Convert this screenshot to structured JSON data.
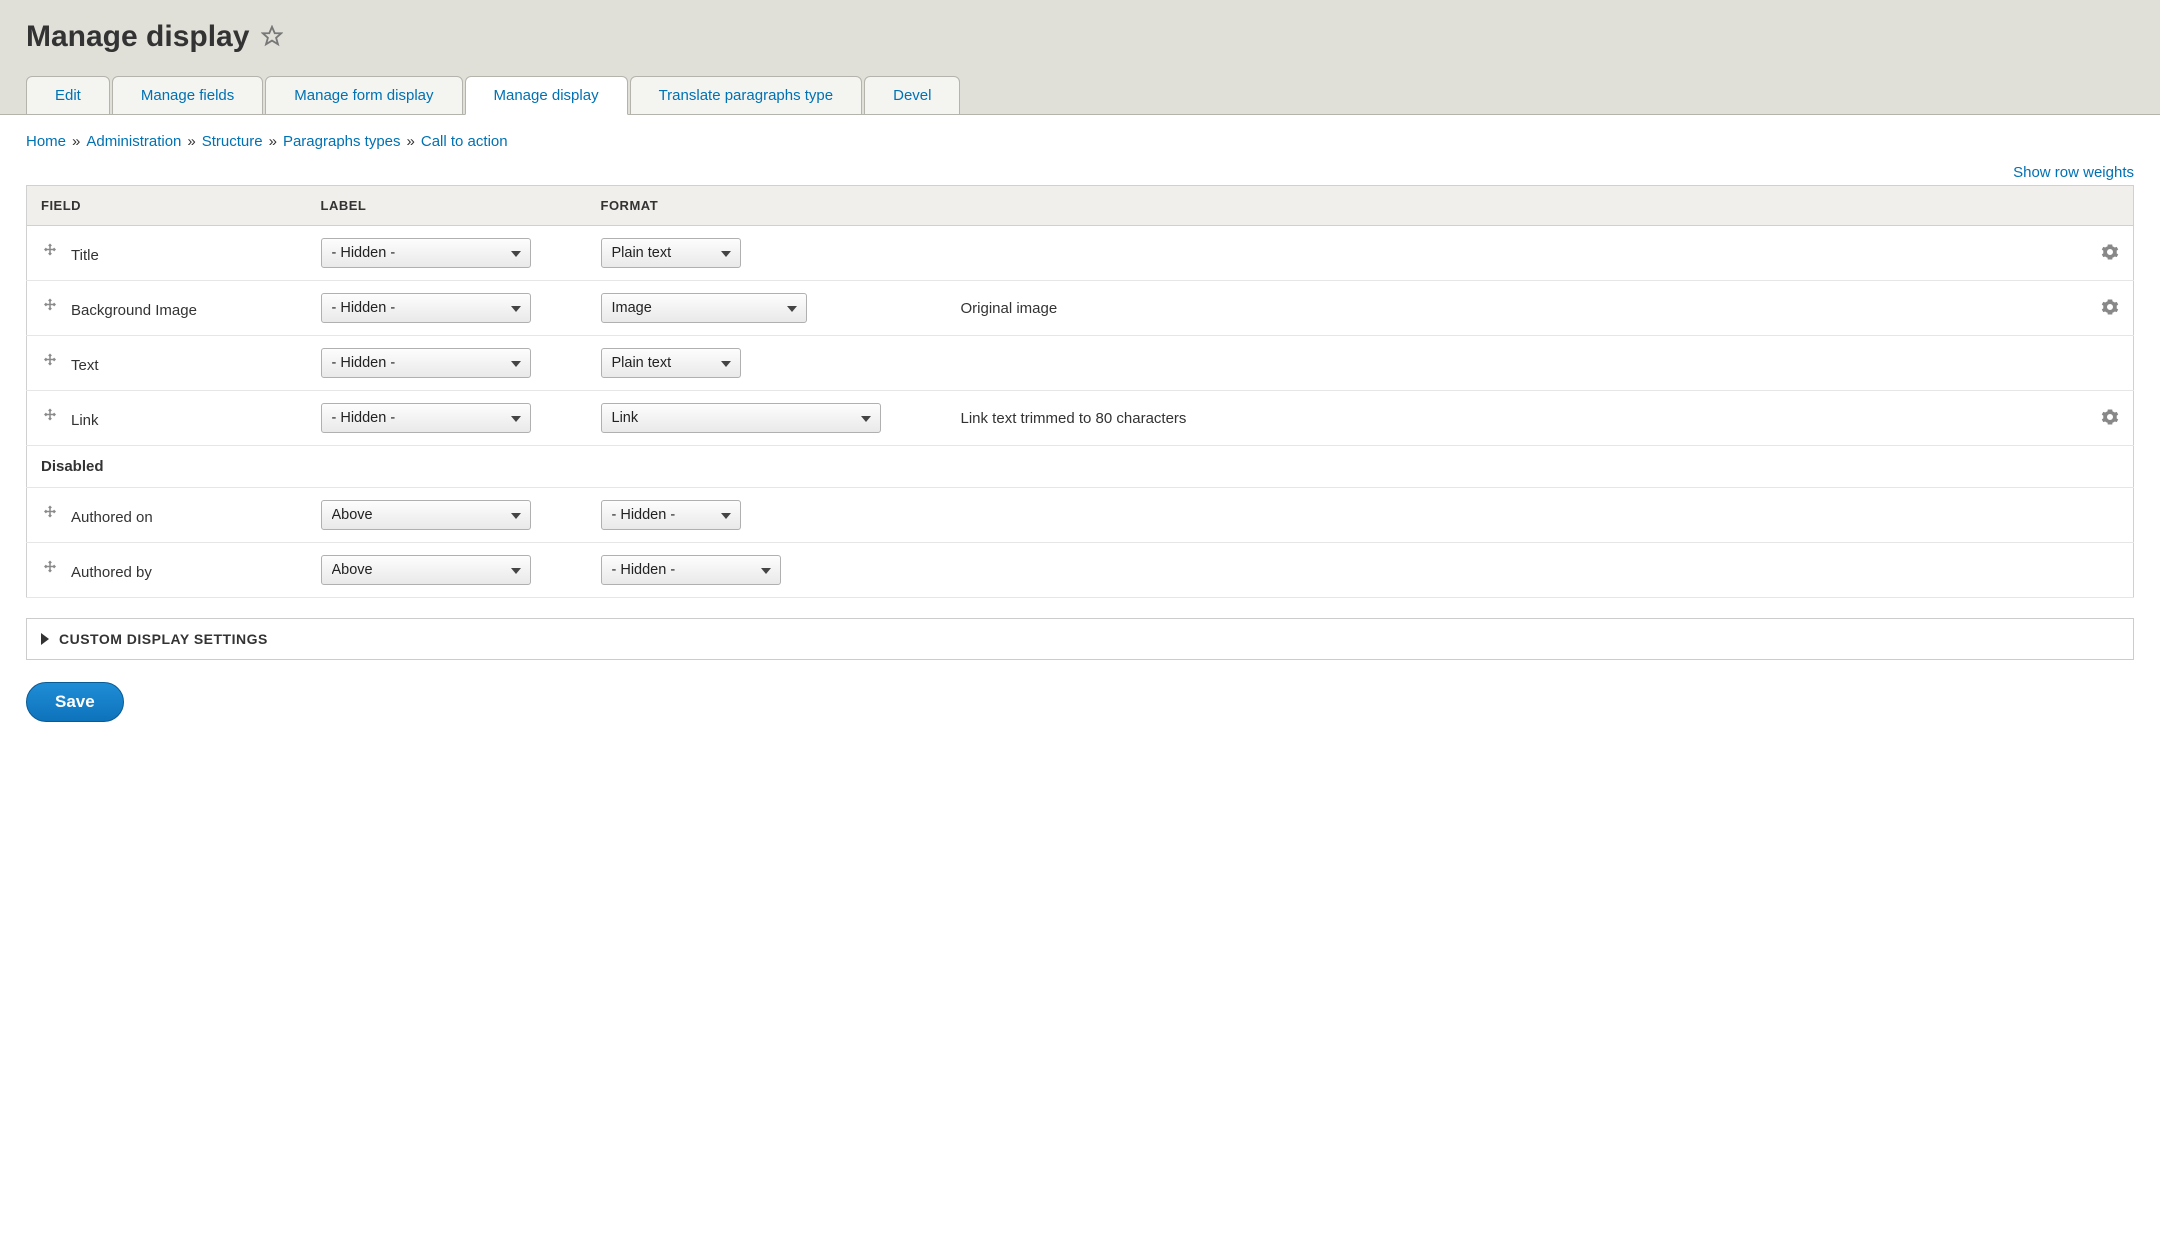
{
  "header": {
    "title": "Manage display"
  },
  "tabs": [
    {
      "label": "Edit",
      "active": false
    },
    {
      "label": "Manage fields",
      "active": false
    },
    {
      "label": "Manage form display",
      "active": false
    },
    {
      "label": "Manage display",
      "active": true
    },
    {
      "label": "Translate paragraphs type",
      "active": false
    },
    {
      "label": "Devel",
      "active": false
    }
  ],
  "breadcrumb": [
    "Home",
    "Administration",
    "Structure",
    "Paragraphs types",
    "Call to action"
  ],
  "weights_toggle": "Show row weights",
  "table": {
    "headers": {
      "field": "FIELD",
      "label": "LABEL",
      "format": "FORMAT"
    },
    "rows": [
      {
        "field": "Title",
        "label": "- Hidden -",
        "format": "Plain text",
        "summary": "",
        "has_gear": true,
        "label_w": 210,
        "format_w": 140
      },
      {
        "field": "Background Image",
        "label": "- Hidden -",
        "format": "Image",
        "summary": "Original image",
        "has_gear": true,
        "label_w": 210,
        "format_w": 206
      },
      {
        "field": "Text",
        "label": "- Hidden -",
        "format": "Plain text",
        "summary": "",
        "has_gear": false,
        "label_w": 210,
        "format_w": 140
      },
      {
        "field": "Link",
        "label": "- Hidden -",
        "format": "Link",
        "summary": "Link text trimmed to 80 characters",
        "has_gear": true,
        "label_w": 210,
        "format_w": 280
      }
    ],
    "disabled_label": "Disabled",
    "disabled_rows": [
      {
        "field": "Authored on",
        "label": "Above",
        "format": "- Hidden -",
        "summary": "",
        "has_gear": false,
        "label_w": 210,
        "format_w": 140
      },
      {
        "field": "Authored by",
        "label": "Above",
        "format": "- Hidden -",
        "summary": "",
        "has_gear": false,
        "label_w": 210,
        "format_w": 180
      }
    ]
  },
  "details": {
    "label": "CUSTOM DISPLAY SETTINGS"
  },
  "actions": {
    "save": "Save"
  }
}
